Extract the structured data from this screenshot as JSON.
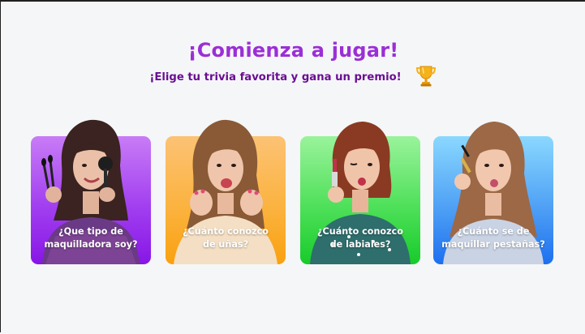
{
  "header": {
    "title": "¡Comienza a jugar!",
    "subtitle": "¡Elige tu trivia favorita y gana un premio!",
    "trophy_icon": "trophy-icon"
  },
  "cards": [
    {
      "label": "¿Que tipo de\nmaquilladora soy?",
      "color": "#a23ff0"
    },
    {
      "label": "¿Cuánto conozco\nde uñas?",
      "color": "#fbb340"
    },
    {
      "label": "¿Cuánto conozco\nde labiales?",
      "color": "#4fe05a"
    },
    {
      "label": "¿Cuánto se de\nmaquillar pestañas?",
      "color": "#4a9cf4"
    }
  ]
}
